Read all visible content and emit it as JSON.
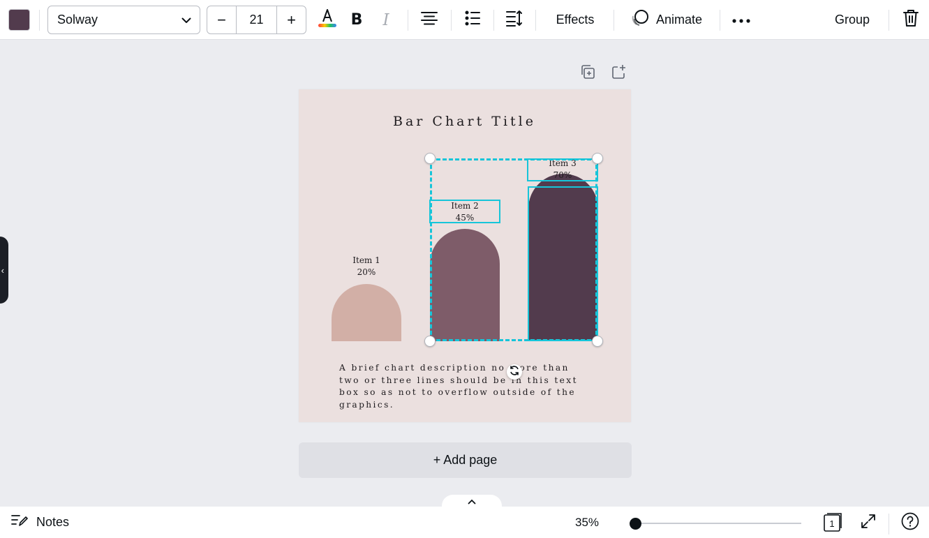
{
  "toolbar": {
    "color_swatch": "#523b4d",
    "font_name": "Solway",
    "font_size": "21",
    "decrease_label": "−",
    "increase_label": "+",
    "effects_label": "Effects",
    "animate_label": "Animate",
    "group_label": "Group",
    "icons": [
      "text-color-icon",
      "bold-icon",
      "italic-icon",
      "align-center-icon",
      "list-icon",
      "spacing-icon",
      "animate-icon",
      "more-icon",
      "trash-icon"
    ]
  },
  "canvas": {
    "page_background": "#ebe0df",
    "page_actions": [
      "duplicate-page-icon",
      "add-page-icon"
    ],
    "add_page_label": "+ Add page"
  },
  "chart_data": {
    "type": "bar",
    "title": "Bar Chart Title",
    "categories": [
      "Item 1",
      "Item 2",
      "Item 3"
    ],
    "values": [
      20,
      45,
      70
    ],
    "value_labels": [
      "20%",
      "45%",
      "70%"
    ],
    "colors": [
      "#d2afa6",
      "#7e5c69",
      "#523b4d"
    ],
    "bar_shape": "rounded-top arch",
    "description": "A brief chart description no more than two or three lines should be in this text box so as not to overflow outside of the graphics."
  },
  "bottom": {
    "notes_label": "Notes",
    "zoom_label": "35%",
    "page_count": "1"
  }
}
